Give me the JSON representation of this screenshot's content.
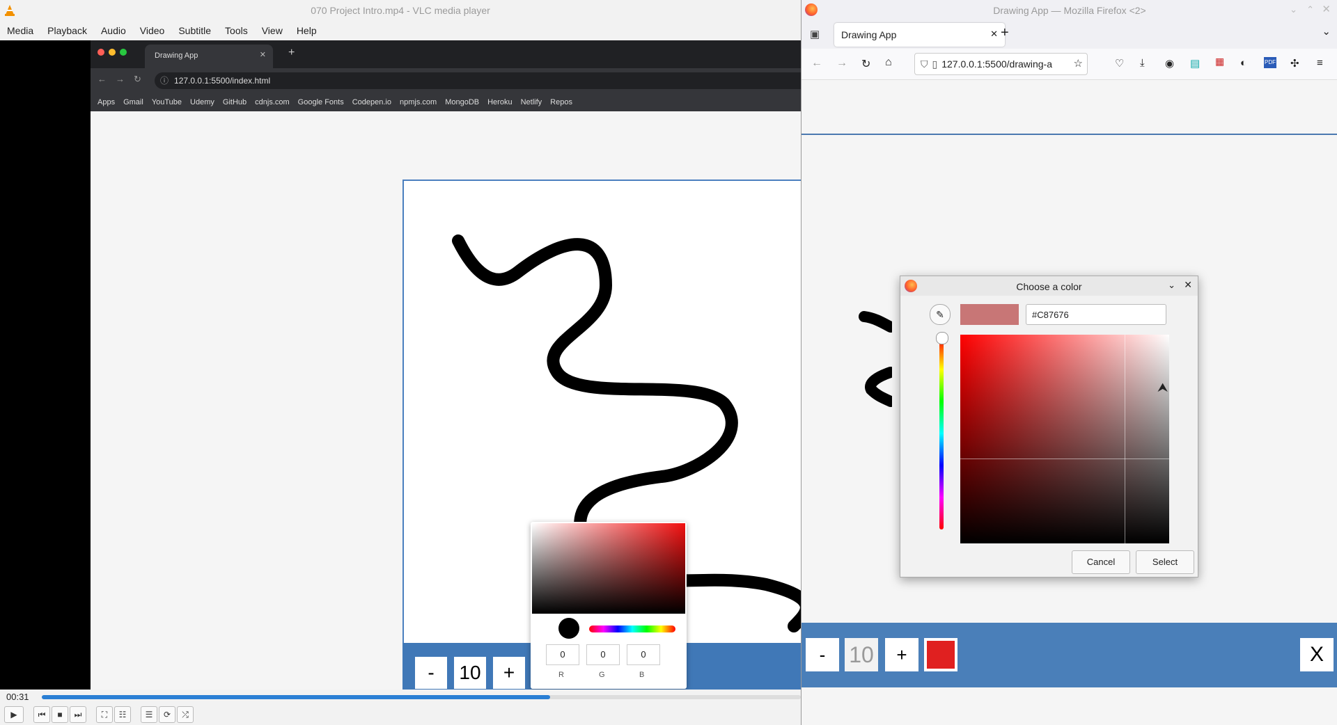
{
  "vlc": {
    "title": "070 Project Intro.mp4 - VLC media player",
    "menu": [
      "Media",
      "Playback",
      "Audio",
      "Video",
      "Subtitle",
      "Tools",
      "View",
      "Help"
    ],
    "time": "00:31",
    "progress_fraction": 0.67
  },
  "video": {
    "tab_title": "Drawing App",
    "url": "127.0.0.1:5500/index.html",
    "bookmarks": [
      "Apps",
      "Gmail",
      "YouTube",
      "Udemy",
      "GitHub",
      "cdnjs.com",
      "Google Fonts",
      "Codepen.io",
      "npmjs.com",
      "MongoDB",
      "Heroku",
      "Netlify",
      "Repos"
    ],
    "toolbox": {
      "minus": "-",
      "size": "10",
      "plus": "+"
    },
    "picker": {
      "r": "0",
      "g": "0",
      "b": "0",
      "r_label": "R",
      "g_label": "G",
      "b_label": "B"
    }
  },
  "firefox": {
    "title": "Drawing App — Mozilla Firefox <2>",
    "tab_title": "Drawing App",
    "url": "127.0.0.1:5500/drawing-a",
    "toolbox": {
      "minus": "-",
      "size": "10",
      "plus": "+",
      "clear": "X",
      "color": "#e02020"
    }
  },
  "dialog": {
    "title": "Choose a color",
    "hex": "#C87676",
    "preview_color": "#C87676",
    "cancel": "Cancel",
    "select": "Select"
  },
  "colors": {
    "accent": "#4078b7",
    "dialog_bg": "#f2f2f2"
  }
}
